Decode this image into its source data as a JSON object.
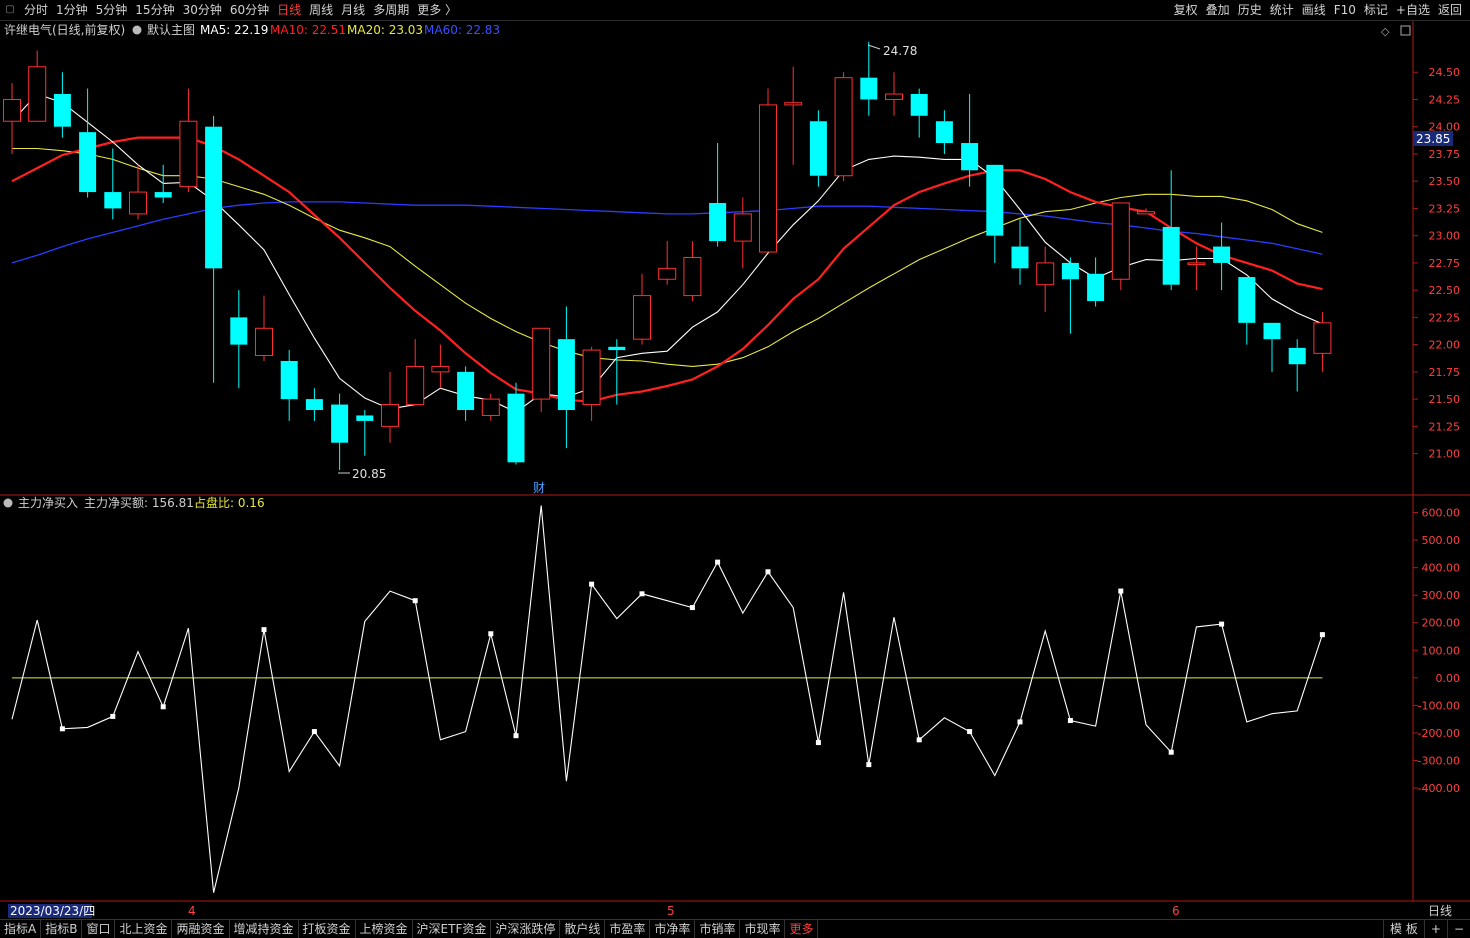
{
  "topbar": {
    "periods": [
      "分时",
      "1分钟",
      "5分钟",
      "15分钟",
      "30分钟",
      "60分钟",
      "日线",
      "周线",
      "月线",
      "多周期",
      "更多 〉"
    ],
    "active_period": "日线",
    "right_buttons": [
      "复权",
      "叠加",
      "历史",
      "统计",
      "画线",
      "F10",
      "标记",
      "+自选",
      "返回"
    ]
  },
  "main_panel": {
    "stock_name": "许继电气(日线,前复权)",
    "template": "默认主图",
    "ma5_label": "MA5: 22.19",
    "ma10_label": "MA10: 22.51",
    "ma20_label": "MA20: 23.03",
    "ma60_label": "MA60: 22.83",
    "high_marker": "24.78",
    "low_marker": "20.85",
    "current_price": "23.85",
    "event_marker": "财"
  },
  "sub_panel": {
    "indicator": "主力净买入",
    "net_label": "主力净买额: 156.81",
    "ratio_label": "占盘比: 0.16"
  },
  "time_axis": {
    "start_date": "2023/03/23/四",
    "month_labels": [
      "4",
      "5",
      "6"
    ],
    "period_label": "日线"
  },
  "bottombar": {
    "tabs": [
      "指标A",
      "指标B",
      "窗口",
      "北上资金",
      "两融资金",
      "增减持资金",
      "打板资金",
      "上榜资金",
      "沪深ETF资金",
      "沪深涨跌停",
      "散户线",
      "市盈率",
      "市净率",
      "市销率",
      "市现率",
      "更多"
    ],
    "right": [
      "模 板",
      "+",
      "−"
    ]
  },
  "colors": {
    "up": "#ff3030",
    "down": "#00ffff",
    "ma5": "#ffffff",
    "ma10": "#ff2020",
    "ma20": "#e8e840",
    "ma60": "#2a3cff",
    "axis": "#b01818"
  },
  "chart_data": [
    {
      "type": "candlestick",
      "y_ticks": [
        21.0,
        21.25,
        21.5,
        21.75,
        22.0,
        22.25,
        22.5,
        22.75,
        23.0,
        23.25,
        23.5,
        23.75,
        24.0,
        24.25,
        24.5
      ],
      "ylim": [
        20.62,
        24.97
      ],
      "candles": [
        {
          "o": 24.05,
          "h": 24.4,
          "l": 23.75,
          "c": 24.25
        },
        {
          "o": 24.05,
          "h": 24.7,
          "l": 24.05,
          "c": 24.55
        },
        {
          "o": 24.3,
          "h": 24.5,
          "l": 23.9,
          "c": 24.0
        },
        {
          "o": 23.95,
          "h": 24.35,
          "l": 23.35,
          "c": 23.4
        },
        {
          "o": 23.4,
          "h": 23.8,
          "l": 23.15,
          "c": 23.25
        },
        {
          "o": 23.2,
          "h": 23.65,
          "l": 23.15,
          "c": 23.4
        },
        {
          "o": 23.4,
          "h": 23.65,
          "l": 23.3,
          "c": 23.35
        },
        {
          "o": 23.45,
          "h": 24.35,
          "l": 23.4,
          "c": 24.05
        },
        {
          "o": 24.0,
          "h": 24.1,
          "l": 21.65,
          "c": 22.7
        },
        {
          "o": 22.25,
          "h": 22.5,
          "l": 21.6,
          "c": 22.0
        },
        {
          "o": 21.9,
          "h": 22.45,
          "l": 21.85,
          "c": 22.15
        },
        {
          "o": 21.85,
          "h": 21.95,
          "l": 21.3,
          "c": 21.5
        },
        {
          "o": 21.5,
          "h": 21.6,
          "l": 21.3,
          "c": 21.4
        },
        {
          "o": 21.45,
          "h": 21.55,
          "l": 20.85,
          "c": 21.1
        },
        {
          "o": 21.35,
          "h": 21.4,
          "l": 20.98,
          "c": 21.3
        },
        {
          "o": 21.25,
          "h": 21.75,
          "l": 21.1,
          "c": 21.45
        },
        {
          "o": 21.45,
          "h": 22.05,
          "l": 21.45,
          "c": 21.8
        },
        {
          "o": 21.75,
          "h": 22.0,
          "l": 21.6,
          "c": 21.8
        },
        {
          "o": 21.75,
          "h": 21.8,
          "l": 21.3,
          "c": 21.4
        },
        {
          "o": 21.35,
          "h": 21.55,
          "l": 21.3,
          "c": 21.5
        },
        {
          "o": 21.55,
          "h": 21.65,
          "l": 20.9,
          "c": 20.92
        },
        {
          "o": 21.5,
          "h": 22.15,
          "l": 21.38,
          "c": 22.15
        },
        {
          "o": 22.05,
          "h": 22.35,
          "l": 21.05,
          "c": 21.4
        },
        {
          "o": 21.45,
          "h": 21.98,
          "l": 21.3,
          "c": 21.95
        },
        {
          "o": 21.98,
          "h": 22.05,
          "l": 21.45,
          "c": 21.95
        },
        {
          "o": 22.05,
          "h": 22.65,
          "l": 22.0,
          "c": 22.45
        },
        {
          "o": 22.6,
          "h": 22.95,
          "l": 22.55,
          "c": 22.7
        },
        {
          "o": 22.45,
          "h": 22.95,
          "l": 22.4,
          "c": 22.8
        },
        {
          "o": 23.3,
          "h": 23.85,
          "l": 22.9,
          "c": 22.95
        },
        {
          "o": 22.95,
          "h": 23.35,
          "l": 22.7,
          "c": 23.2
        },
        {
          "o": 22.85,
          "h": 24.35,
          "l": 22.85,
          "c": 24.2
        },
        {
          "o": 24.2,
          "h": 24.55,
          "l": 23.65,
          "c": 24.22
        },
        {
          "o": 24.05,
          "h": 24.15,
          "l": 23.45,
          "c": 23.55
        },
        {
          "o": 23.55,
          "h": 24.5,
          "l": 23.5,
          "c": 24.45
        },
        {
          "o": 24.45,
          "h": 24.78,
          "l": 24.1,
          "c": 24.25
        },
        {
          "o": 24.25,
          "h": 24.5,
          "l": 24.1,
          "c": 24.3
        },
        {
          "o": 24.3,
          "h": 24.35,
          "l": 23.9,
          "c": 24.1
        },
        {
          "o": 24.05,
          "h": 24.15,
          "l": 23.75,
          "c": 23.85
        },
        {
          "o": 23.85,
          "h": 24.3,
          "l": 23.45,
          "c": 23.6
        },
        {
          "o": 23.65,
          "h": 23.65,
          "l": 22.75,
          "c": 23.0
        },
        {
          "o": 22.9,
          "h": 23.15,
          "l": 22.55,
          "c": 22.7
        },
        {
          "o": 22.55,
          "h": 22.9,
          "l": 22.3,
          "c": 22.75
        },
        {
          "o": 22.75,
          "h": 22.8,
          "l": 22.1,
          "c": 22.6
        },
        {
          "o": 22.65,
          "h": 22.8,
          "l": 22.35,
          "c": 22.4
        },
        {
          "o": 22.6,
          "h": 23.3,
          "l": 22.5,
          "c": 23.3
        },
        {
          "o": 23.2,
          "h": 23.25,
          "l": 23.2,
          "c": 23.22
        },
        {
          "o": 23.08,
          "h": 23.6,
          "l": 22.5,
          "c": 22.55
        },
        {
          "o": 22.75,
          "h": 22.9,
          "l": 22.5,
          "c": 22.75
        },
        {
          "o": 22.9,
          "h": 23.12,
          "l": 22.5,
          "c": 22.75
        },
        {
          "o": 22.62,
          "h": 22.62,
          "l": 22.0,
          "c": 22.2
        },
        {
          "o": 22.2,
          "h": 22.2,
          "l": 21.75,
          "c": 22.05
        },
        {
          "o": 21.97,
          "h": 22.05,
          "l": 21.57,
          "c": 21.82
        },
        {
          "o": 21.92,
          "h": 22.3,
          "l": 21.75,
          "c": 22.2
        }
      ],
      "ma5": [
        24.05,
        24.3,
        24.22,
        24.04,
        23.86,
        23.65,
        23.48,
        23.49,
        23.32,
        23.1,
        22.87,
        22.46,
        22.06,
        21.69,
        21.51,
        21.41,
        21.45,
        21.6,
        21.53,
        21.49,
        21.38,
        21.55,
        21.52,
        21.6,
        21.88,
        21.92,
        21.94,
        22.16,
        22.3,
        22.55,
        22.84,
        23.1,
        23.32,
        23.6,
        23.7,
        23.73,
        23.72,
        23.7,
        23.7,
        23.53,
        23.24,
        22.94,
        22.75,
        22.61,
        22.71,
        22.78,
        22.77,
        22.79,
        22.79,
        22.64,
        22.42,
        22.29,
        22.19
      ],
      "ma10": [
        23.5,
        23.62,
        23.74,
        23.8,
        23.86,
        23.9,
        23.9,
        23.9,
        23.82,
        23.7,
        23.55,
        23.4,
        23.19,
        22.98,
        22.75,
        22.52,
        22.31,
        22.13,
        21.92,
        21.74,
        21.59,
        21.55,
        21.49,
        21.48,
        21.54,
        21.57,
        21.62,
        21.68,
        21.8,
        21.96,
        22.18,
        22.42,
        22.6,
        22.88,
        23.08,
        23.28,
        23.4,
        23.48,
        23.55,
        23.6,
        23.6,
        23.52,
        23.4,
        23.31,
        23.26,
        23.22,
        23.07,
        22.93,
        22.82,
        22.75,
        22.68,
        22.56,
        22.51
      ],
      "ma20": [
        23.8,
        23.8,
        23.78,
        23.75,
        23.7,
        23.62,
        23.55,
        23.55,
        23.52,
        23.45,
        23.38,
        23.28,
        23.16,
        23.05,
        22.98,
        22.9,
        22.72,
        22.55,
        22.38,
        22.24,
        22.12,
        22.02,
        21.94,
        21.88,
        21.86,
        21.85,
        21.82,
        21.8,
        21.82,
        21.88,
        21.98,
        22.12,
        22.24,
        22.38,
        22.52,
        22.65,
        22.78,
        22.88,
        22.98,
        23.07,
        23.16,
        23.22,
        23.24,
        23.3,
        23.35,
        23.38,
        23.38,
        23.36,
        23.36,
        23.32,
        23.24,
        23.11,
        23.03
      ],
      "ma60": [
        22.75,
        22.82,
        22.9,
        22.97,
        23.03,
        23.09,
        23.15,
        23.2,
        23.25,
        23.28,
        23.3,
        23.31,
        23.31,
        23.31,
        23.3,
        23.29,
        23.28,
        23.28,
        23.28,
        23.27,
        23.26,
        23.25,
        23.24,
        23.23,
        23.22,
        23.21,
        23.2,
        23.2,
        23.21,
        23.22,
        23.23,
        23.25,
        23.27,
        23.27,
        23.27,
        23.26,
        23.25,
        23.24,
        23.23,
        23.22,
        23.2,
        23.18,
        23.15,
        23.12,
        23.1,
        23.07,
        23.04,
        23.02,
        22.99,
        22.96,
        22.93,
        22.88,
        22.83
      ]
    },
    {
      "type": "line",
      "name": "主力净买入",
      "y_ticks": [
        600,
        500,
        400,
        300,
        200,
        100,
        0,
        -100,
        -200,
        -300,
        -400
      ],
      "ylim": [
        -810,
        660
      ],
      "values": [
        -150,
        210,
        -185,
        -180,
        -140,
        95,
        -105,
        180,
        -780,
        -400,
        175,
        -340,
        -195,
        -320,
        205,
        315,
        280,
        -225,
        -195,
        160,
        -210,
        625,
        -375,
        340,
        215,
        305,
        280,
        255,
        420,
        235,
        385,
        255,
        -235,
        310,
        -315,
        220,
        -225,
        -145,
        -195,
        -355,
        -160,
        170,
        -155,
        -175,
        315,
        -170,
        -270,
        185,
        195,
        -160,
        -130,
        -120,
        156.81
      ],
      "markers": [
        2,
        4,
        6,
        10,
        12,
        16,
        19,
        20,
        23,
        25,
        27,
        28,
        30,
        32,
        34,
        36,
        38,
        40,
        42,
        44,
        46,
        48,
        52
      ]
    }
  ]
}
